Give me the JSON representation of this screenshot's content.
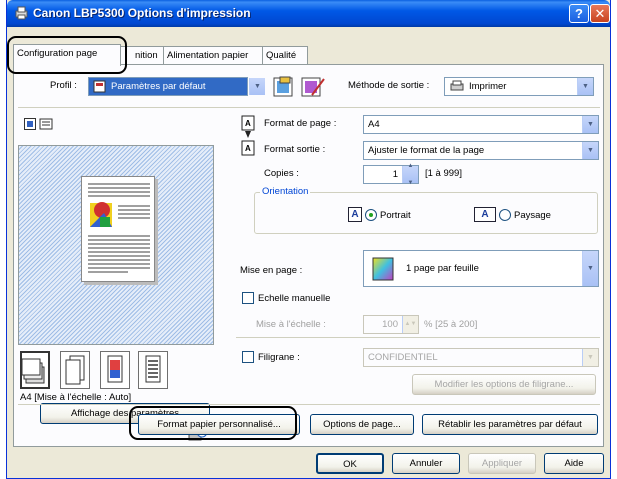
{
  "window": {
    "title": "Canon LBP5300 Options d'impression",
    "help_glyph": "?",
    "close_glyph": "✕"
  },
  "tabs": [
    {
      "label": "Configuration page",
      "active": true
    },
    {
      "label": "nition",
      "active": false
    },
    {
      "label": "Alimentation papier",
      "active": false
    },
    {
      "label": "Qualité",
      "active": false
    }
  ],
  "profile": {
    "label": "Profil :",
    "value": "Paramètres par défaut",
    "output_method_label": "Méthode de sortie :",
    "output_method_value": "Imprimer"
  },
  "page_settings": {
    "page_size_label": "Format de page :",
    "page_size_value": "A4",
    "output_size_label": "Format sortie :",
    "output_size_value": "Ajuster le format de la page",
    "copies_label": "Copies :",
    "copies_value": "1",
    "copies_range": "[1 à 999]",
    "orientation_title": "Orientation",
    "portrait_label": "Portrait",
    "landscape_label": "Paysage",
    "orientation_selected": "Portrait",
    "layout_label": "Mise en page :",
    "layout_value": "1 page par feuille",
    "manual_scaling_label": "Echelle manuelle",
    "manual_scaling_checked": false,
    "scaling_label": "Mise à l'échelle :",
    "scaling_value": "100",
    "scaling_range": "% [25 à 200]",
    "watermark_label": "Filigrane :",
    "watermark_checked": false,
    "watermark_value": "CONFIDENTIEL",
    "watermark_edit_button": "Modifier les options de filigrane..."
  },
  "preview": {
    "caption": "A4 [Mise à l'échelle : Auto]",
    "view_settings_button": "Affichage des paramètres"
  },
  "bottom_buttons": {
    "custom_paper": "Format papier personnalisé...",
    "page_options": "Options de page...",
    "restore_defaults": "Rétablir les paramètres par défaut"
  },
  "dialog_buttons": {
    "ok": "OK",
    "cancel": "Annuler",
    "apply": "Appliquer",
    "help": "Aide"
  },
  "icons": {
    "portrait_letter": "A",
    "landscape_letter": "A"
  },
  "colors": {
    "titlebar": "#0058e6",
    "dialog_bg": "#ece9d8",
    "highlight": "#000000"
  }
}
